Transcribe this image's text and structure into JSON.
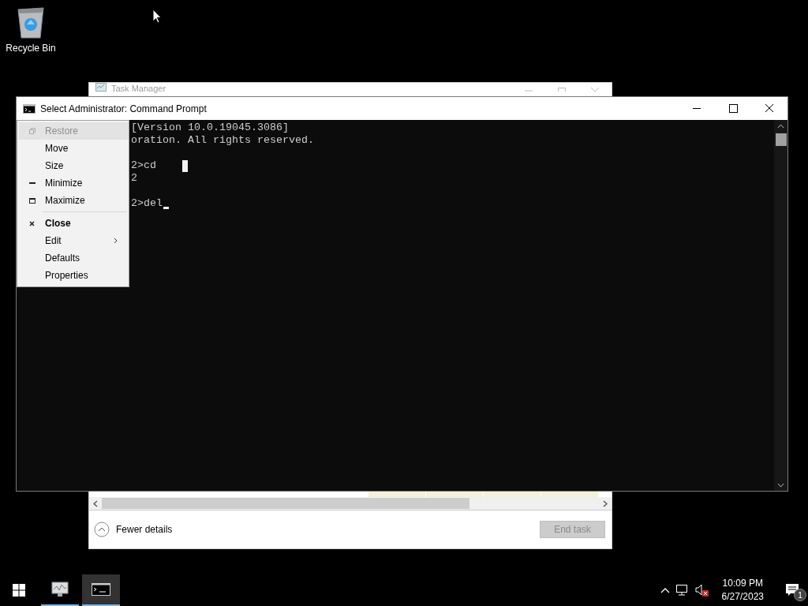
{
  "desktop": {
    "icons": [
      {
        "label": "Recycle Bin",
        "kind": "recycle-bin"
      }
    ]
  },
  "task_manager": {
    "title": "Task Manager",
    "fewer_details": "Fewer details",
    "end_task": {
      "label": "End task",
      "disabled": true
    }
  },
  "cmd_window": {
    "title": "Select Administrator:  Command Prompt",
    "lines": [
      {
        "text": "[Version 10.0.19045.3086]",
        "kind": "plain"
      },
      {
        "text": "oration. All rights reserved.",
        "kind": "plain"
      },
      {
        "kind": "blank"
      },
      {
        "text": "2>cd",
        "kind": "block-cursor"
      },
      {
        "text": "2",
        "kind": "plain"
      },
      {
        "kind": "blank"
      },
      {
        "text": "2>del",
        "kind": "underline-cursor"
      }
    ]
  },
  "system_menu": {
    "items": [
      {
        "label": "Restore",
        "kind": "restore",
        "disabled": true,
        "selected": true,
        "default": false
      },
      {
        "label": "Move",
        "kind": "plain",
        "disabled": false,
        "selected": false,
        "default": false
      },
      {
        "label": "Size",
        "kind": "plain",
        "disabled": false,
        "selected": false,
        "default": false
      },
      {
        "label": "Minimize",
        "kind": "minimize",
        "disabled": false,
        "selected": false,
        "default": false
      },
      {
        "label": "Maximize",
        "kind": "maximize",
        "disabled": false,
        "selected": false,
        "default": false
      },
      {
        "kind": "separator"
      },
      {
        "label": "Close",
        "kind": "close",
        "disabled": false,
        "selected": false,
        "default": true
      },
      {
        "label": "Edit",
        "kind": "submenu",
        "disabled": false,
        "selected": false,
        "default": false
      },
      {
        "label": "Defaults",
        "kind": "plain",
        "disabled": false,
        "selected": false,
        "default": false
      },
      {
        "label": "Properties",
        "kind": "plain",
        "disabled": false,
        "selected": false,
        "default": false
      }
    ]
  },
  "taskbar": {
    "apps": [
      {
        "kind": "task-manager",
        "selected": false
      },
      {
        "kind": "command-prompt",
        "selected": true
      }
    ],
    "tray": {
      "volume_muted": true,
      "time": "10:09 PM",
      "date": "6/27/2023",
      "notification_count": "1"
    }
  }
}
